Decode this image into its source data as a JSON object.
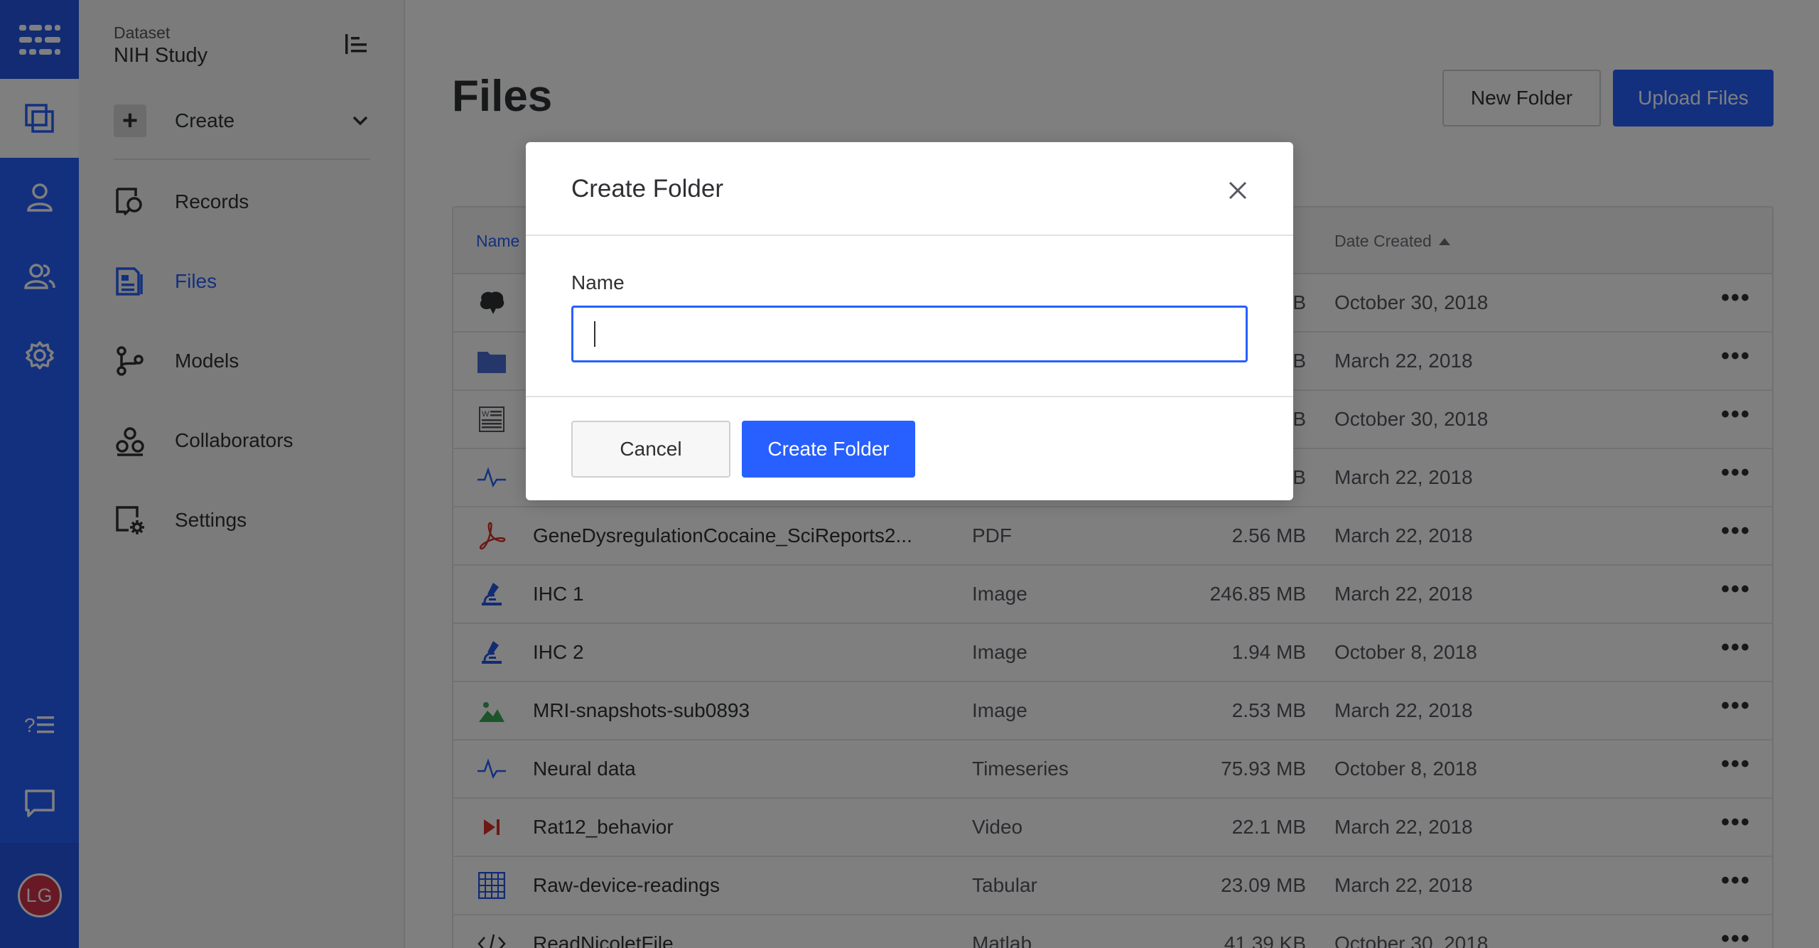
{
  "rail": {
    "logo_icon": "app-logo-icon",
    "items": [
      {
        "icon": "datasets-icon",
        "active": true
      },
      {
        "icon": "user-icon"
      },
      {
        "icon": "team-icon"
      },
      {
        "icon": "settings-gear-icon"
      },
      {
        "icon": "help-list-icon"
      },
      {
        "icon": "chat-icon"
      }
    ],
    "avatar_initials": "LG"
  },
  "sidebar": {
    "caption": "Dataset",
    "dataset_name": "NIH Study",
    "create_label": "Create",
    "items": [
      {
        "label": "Records",
        "icon": "records-icon"
      },
      {
        "label": "Files",
        "icon": "files-icon",
        "active": true
      },
      {
        "label": "Models",
        "icon": "models-icon"
      },
      {
        "label": "Collaborators",
        "icon": "collaborators-icon"
      },
      {
        "label": "Settings",
        "icon": "settings-icon"
      }
    ]
  },
  "main": {
    "title": "Files",
    "new_folder_label": "New Folder",
    "upload_label": "Upload Files",
    "table": {
      "col_name": "Name",
      "col_date": "Date Created",
      "rows": [
        {
          "name": "",
          "type": "",
          "size": "KB",
          "date": "October 30, 2018",
          "icon": "brain-icon"
        },
        {
          "name": "",
          "type": "",
          "size": "MB",
          "date": "March 22, 2018",
          "icon": "folder-icon"
        },
        {
          "name": "",
          "type": "",
          "size": "KB",
          "date": "October 30, 2018",
          "icon": "word-doc-icon"
        },
        {
          "name": "",
          "type": "",
          "size": "GB",
          "date": "March 22, 2018",
          "icon": "timeseries-icon"
        },
        {
          "name": "GeneDysregulationCocaine_SciReports2...",
          "type": "PDF",
          "size": "2.56 MB",
          "date": "March 22, 2018",
          "icon": "pdf-icon"
        },
        {
          "name": "IHC 1",
          "type": "Image",
          "size": "246.85 MB",
          "date": "March 22, 2018",
          "icon": "microscope-icon"
        },
        {
          "name": "IHC 2",
          "type": "Image",
          "size": "1.94 MB",
          "date": "October 8, 2018",
          "icon": "microscope-icon"
        },
        {
          "name": "MRI-snapshots-sub0893",
          "type": "Image",
          "size": "2.53 MB",
          "date": "March 22, 2018",
          "icon": "image-icon"
        },
        {
          "name": "Neural data",
          "type": "Timeseries",
          "size": "75.93 MB",
          "date": "October 8, 2018",
          "icon": "timeseries-icon"
        },
        {
          "name": "Rat12_behavior",
          "type": "Video",
          "size": "22.1 MB",
          "date": "March 22, 2018",
          "icon": "video-icon"
        },
        {
          "name": "Raw-device-readings",
          "type": "Tabular",
          "size": "23.09 MB",
          "date": "March 22, 2018",
          "icon": "table-icon"
        },
        {
          "name": "ReadNicoletFile",
          "type": "Matlab",
          "size": "41.39 KB",
          "date": "October 30, 2018",
          "icon": "code-icon"
        }
      ]
    }
  },
  "modal": {
    "title": "Create Folder",
    "field_label": "Name",
    "input_value": "",
    "cancel_label": "Cancel",
    "submit_label": "Create Folder"
  },
  "colors": {
    "accent": "#2760ff",
    "rail": "#2760ff",
    "pdf": "#d9312b",
    "image": "#3aa857"
  }
}
